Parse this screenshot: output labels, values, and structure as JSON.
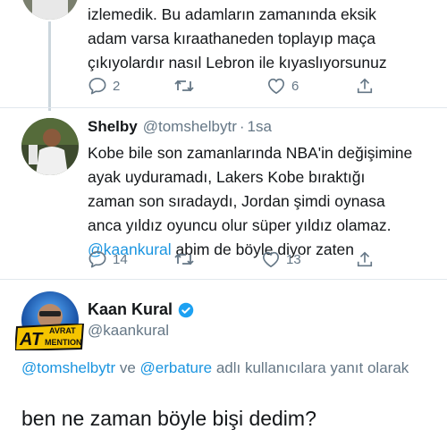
{
  "tweet_top": {
    "text_line_1": "izlemedik. Bu adamların zamanında eksik",
    "text_line_2": "adam varsa kıraathaneden toplayıp maça",
    "text_line_3": "çıkıyolardır nasıl Lebron ile kıyaslıyorsunuz",
    "reply_count": "2",
    "like_count": "6",
    "icons": [
      "reply-icon",
      "retweet-icon",
      "like-icon",
      "share-icon"
    ]
  },
  "tweet_shelby": {
    "name": "Shelby",
    "handle": "@tomshelbytr",
    "dot": "·",
    "time": "1sa",
    "text": "Kobe bile son zamanlarında NBA'in değişimine\nayak uyduramadı, Lakers Kobe bıraktığı\nzaman son sıradaydı, Jordan şimdi oynasa\nanca yıldız oyuncu olur süper yıldız olamaz.",
    "mention": "@kaankural",
    "text_tail": " abim de böyle diyor zaten",
    "reply_count": "14",
    "like_count": "13"
  },
  "tweet_main": {
    "name": "Kaan Kural",
    "handle": "@kaankural",
    "badge_line_1": "AT",
    "badge_line_2": "AVRAT",
    "badge_line_3": "MENTION",
    "reply_mention_1": "@tomshelbytr",
    "reply_ve": " ve ",
    "reply_mention_2": "@erbature",
    "reply_suffix": " adlı kullanıcılara yanıt olarak",
    "text": "ben ne zaman böyle bişi dedim?"
  },
  "colors": {
    "link": "#1b95e0",
    "secondary": "#657786",
    "verified": "#1da1f2",
    "badge_yellow": "#f5c400"
  }
}
